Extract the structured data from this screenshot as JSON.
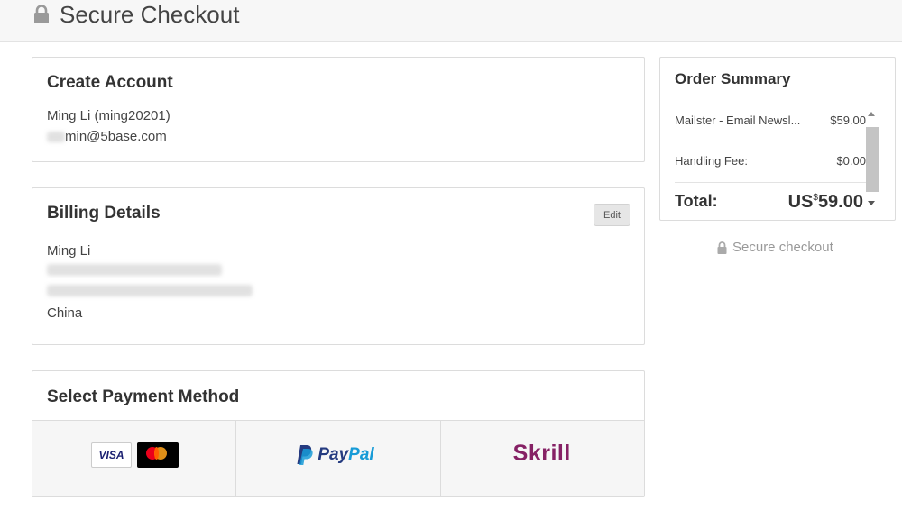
{
  "header": {
    "title": "Secure Checkout",
    "icon": "lock-icon"
  },
  "account": {
    "title": "Create Account",
    "name": "Ming Li (ming20201)",
    "email_visible": "min@5base.com"
  },
  "billing": {
    "title": "Billing Details",
    "edit_label": "Edit",
    "name": "Ming Li",
    "country": "China"
  },
  "payment": {
    "title": "Select Payment Method",
    "methods": [
      {
        "visa_label": "VISA"
      },
      {
        "paypal_pay": "Pay",
        "paypal_pal": "Pal"
      },
      {
        "skrill_label": "Skrill"
      }
    ]
  },
  "summary": {
    "title": "Order Summary",
    "items": [
      {
        "label": "Mailster - Email Newsl...",
        "value": "$59.00"
      },
      {
        "label": "Handling Fee:",
        "value": "$0.00"
      }
    ],
    "total_label": "Total:",
    "total_prefix": "US",
    "total_sup": "$",
    "total_value": "59.00"
  },
  "secure_note": "Secure checkout",
  "colors": {
    "skrill": "#862165",
    "paypal_dark": "#253b80",
    "paypal_light": "#179bd7",
    "mastercard_red": "#eb001b",
    "mastercard_orange": "#f79e1b"
  }
}
